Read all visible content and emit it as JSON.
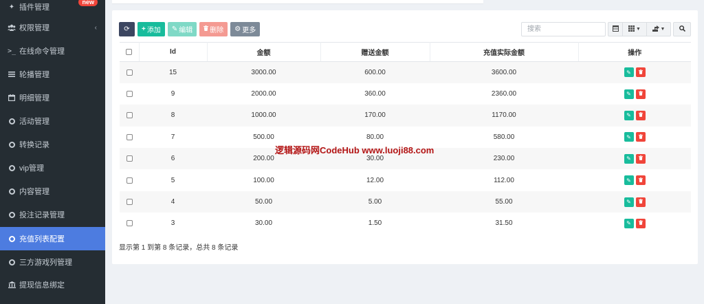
{
  "sidebar": {
    "items": [
      {
        "label": "插件管理",
        "icon": "plugin-icon",
        "badge": "new"
      },
      {
        "label": "权限管理",
        "icon": "users-icon",
        "chevron": "‹"
      },
      {
        "label": "在线命令管理",
        "icon": "terminal-icon"
      },
      {
        "label": "轮播管理",
        "icon": "list-icon"
      },
      {
        "label": "明细管理",
        "icon": "calendar-icon"
      },
      {
        "label": "活动管理",
        "icon": "circle-icon"
      },
      {
        "label": "转换记录",
        "icon": "circle-icon"
      },
      {
        "label": "vip管理",
        "icon": "circle-icon"
      },
      {
        "label": "内容管理",
        "icon": "circle-icon"
      },
      {
        "label": "投注记录管理",
        "icon": "circle-icon"
      },
      {
        "label": "充值列表配置",
        "icon": "circle-icon",
        "active": true
      },
      {
        "label": "三方游戏列管理",
        "icon": "circle-icon"
      },
      {
        "label": "提现信息绑定",
        "icon": "bank-icon"
      }
    ]
  },
  "toolbar": {
    "add_label": "添加",
    "edit_label": "编辑",
    "delete_label": "删除",
    "more_label": "更多"
  },
  "search": {
    "placeholder": "搜索"
  },
  "table": {
    "headers": [
      "Id",
      "金额",
      "赠送金额",
      "充值实际金额",
      "操作"
    ],
    "rows": [
      {
        "id": "15",
        "amount": "3000.00",
        "bonus": "600.00",
        "actual": "3600.00"
      },
      {
        "id": "9",
        "amount": "2000.00",
        "bonus": "360.00",
        "actual": "2360.00"
      },
      {
        "id": "8",
        "amount": "1000.00",
        "bonus": "170.00",
        "actual": "1170.00"
      },
      {
        "id": "7",
        "amount": "500.00",
        "bonus": "80.00",
        "actual": "580.00"
      },
      {
        "id": "6",
        "amount": "200.00",
        "bonus": "30.00",
        "actual": "230.00"
      },
      {
        "id": "5",
        "amount": "100.00",
        "bonus": "12.00",
        "actual": "112.00"
      },
      {
        "id": "4",
        "amount": "50.00",
        "bonus": "5.00",
        "actual": "55.00"
      },
      {
        "id": "3",
        "amount": "30.00",
        "bonus": "1.50",
        "actual": "31.50"
      }
    ]
  },
  "summary": "显示第 1 到第 8 条记录，总共 8 条记录",
  "watermark": "逻辑源码网CodeHub  www.luoji88.com",
  "colors": {
    "sidebar_bg": "#252d33",
    "active_item": "#4d7ce0",
    "primary": "#18bc9c",
    "danger": "#f0453a",
    "navy": "#3c4660"
  }
}
